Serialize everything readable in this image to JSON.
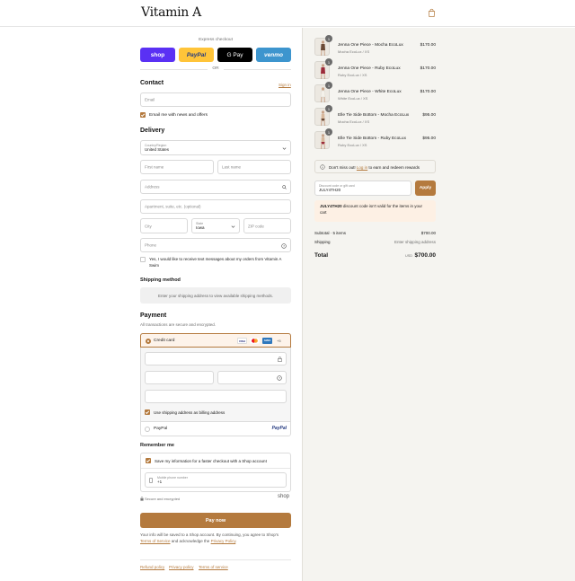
{
  "header": {
    "logo_text": "Vitamin A",
    "bag_icon": "shopping-bag-icon"
  },
  "express": {
    "title": "Express checkout",
    "buttons": [
      {
        "label": "shop",
        "bg": "#5a31f4",
        "color": "#ffffff"
      },
      {
        "label": "PayPal",
        "bg": "#ffc439",
        "color": "#253b80"
      },
      {
        "label": "G Pay",
        "bg": "#000000",
        "color": "#ffffff"
      },
      {
        "label": "venmo",
        "bg": "#3d95ce",
        "color": "#ffffff"
      }
    ],
    "or_label": "OR"
  },
  "contact": {
    "title": "Contact",
    "sign_in_label": "Sign in",
    "email_placeholder": "Email",
    "email_news_label": "Email me with news and offers"
  },
  "delivery": {
    "title": "Delivery",
    "country_label": "Country/Region",
    "country_value": "United States",
    "first_name_placeholder": "First name",
    "last_name_placeholder": "Last name",
    "address_placeholder": "Address",
    "apartment_placeholder": "Apartment, suite, etc. (optional)",
    "city_placeholder": "City",
    "state_label": "State",
    "state_value": "Iowa",
    "zip_placeholder": "ZIP code",
    "phone_placeholder": "Phone",
    "sms_label_line1": "Yes, I would like to receive text messages about my orders from Vitamin A",
    "sms_label_line2": "Swim"
  },
  "shipping": {
    "title": "Shipping method",
    "message": "Enter your shipping address to view available shipping methods."
  },
  "payment": {
    "title": "Payment",
    "subtitle": "All transactions are secure and encrypted.",
    "credit_card_label": "Credit card",
    "card_brands": [
      "VISA",
      "MC",
      "AMEX"
    ],
    "more_label": "+5",
    "billing_label": "Use shipping address as billing address",
    "paypal_label": "PayPal",
    "paypal_logo": "PayPal"
  },
  "remember": {
    "title": "Remember me",
    "save_label": "Save my information for a faster checkout with a Shop account",
    "mobile_label": "Mobile phone number",
    "mobile_value": "+1",
    "secure_label": "Secure and encrypted",
    "shop_logo": "shop"
  },
  "pay_now": {
    "label": "Pay now",
    "color": "#b47a3e"
  },
  "legal": {
    "text1": "Your info will be saved to a Shop account. By continuing, you agree to Shop's",
    "terms_link": "Terms of Service",
    "text2": "and acknowledge the",
    "privacy_link": "Privacy Policy",
    "text3": "."
  },
  "footer_links": [
    "Refund policy",
    "Privacy policy",
    "Terms of service"
  ],
  "cart": {
    "items": [
      {
        "name": "Jenna One Piece - Mocha EcoLux",
        "variant": "Mocha EcoLux / XS",
        "price": "$170.00",
        "qty": "1"
      },
      {
        "name": "Jenna One Piece - Ruby EcoLux",
        "variant": "Ruby EcoLux / XS",
        "price": "$170.00",
        "qty": "1"
      },
      {
        "name": "Jenna One Piece - White EcoLux",
        "variant": "White EcoLux / XS",
        "price": "$170.00",
        "qty": "1"
      },
      {
        "name": "Elle Tie Side Bottom - Mocha EcoLux",
        "variant": "Mocha EcoLux / XS",
        "price": "$95.00",
        "qty": "1"
      },
      {
        "name": "Elle Tie Side Bottom - Ruby EcoLux",
        "variant": "Ruby EcoLux / XS",
        "price": "$95.00",
        "qty": "1"
      }
    ],
    "rewards_prefix": "Don't miss out!",
    "rewards_link": "Log in",
    "rewards_suffix": "to earn and redeem rewards",
    "discount_label": "Discount code or gift card",
    "discount_value": "JULY4TH20",
    "apply_label": "Apply",
    "error_code": "JULY4TH20",
    "error_line1": "discount code isn't valid for the items in your",
    "error_line2": "cart",
    "subtotal_label": "Subtotal · 5 items",
    "subtotal_value": "$700.00",
    "shipping_label": "Shipping",
    "shipping_value": "Enter shipping address",
    "total_label": "Total",
    "currency": "USD",
    "total_value": "$700.00"
  }
}
